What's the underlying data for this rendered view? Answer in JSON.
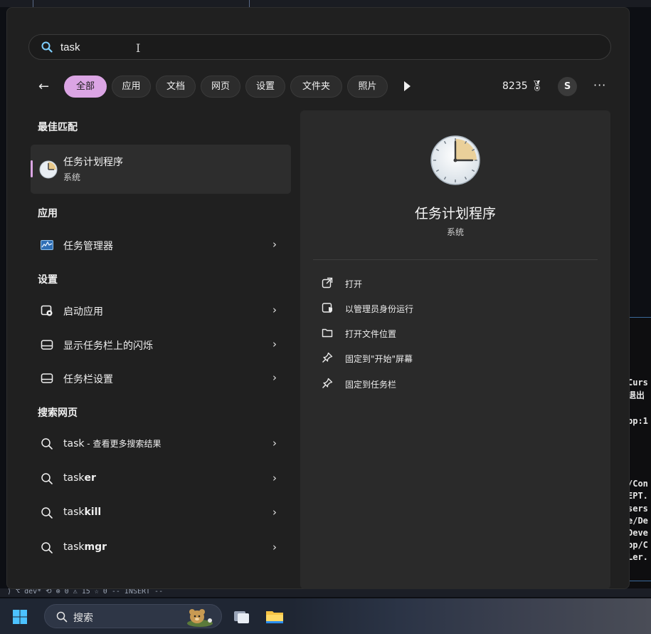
{
  "search": {
    "query": "task"
  },
  "filters": {
    "back_label": "←",
    "chips": [
      "全部",
      "应用",
      "文档",
      "网页",
      "设置",
      "文件夹",
      "照片"
    ],
    "points": "8235",
    "avatar_initial": "S",
    "more": "···"
  },
  "sections": {
    "best_match": "最佳匹配",
    "apps": "应用",
    "settings": "设置",
    "web": "搜索网页"
  },
  "best_match": {
    "title": "任务计划程序",
    "subtitle": "系统"
  },
  "apps": [
    {
      "label": "任务管理器"
    }
  ],
  "settings": [
    {
      "label": "启动应用"
    },
    {
      "label": "显示任务栏上的闪烁"
    },
    {
      "label": "任务栏设置"
    }
  ],
  "web": [
    {
      "prefix": "task",
      "suffix": " - 查看更多搜索结果"
    },
    {
      "prefix": "task",
      "bold": "er"
    },
    {
      "prefix": "task",
      "bold": "kill"
    },
    {
      "prefix": "task",
      "bold": "mgr"
    }
  ],
  "preview": {
    "title": "任务计划程序",
    "subtitle": "系统",
    "actions": [
      {
        "label": "打开",
        "icon": "open-icon"
      },
      {
        "label": "以管理员身份运行",
        "icon": "shield-icon"
      },
      {
        "label": "打开文件位置",
        "icon": "folder-icon"
      },
      {
        "label": "固定到\"开始\"屏幕",
        "icon": "pin-icon"
      },
      {
        "label": "固定到任务栏",
        "icon": "pin-icon"
      }
    ]
  },
  "taskbar": {
    "search_label": "搜索"
  },
  "background": {
    "status_line": "⟩  ⌥ dev* ⟲  ⊗ 0 ⚠ 15   ☆ 0   -- INSERT --",
    "terminal_lines": [
      "Curs",
      "退出",
      "pp:1",
      "/Con",
      "EPT.",
      "sers",
      "e/De",
      "Deve",
      "pp/C",
      "Ler."
    ]
  },
  "colors": {
    "accent": "#dba5e4",
    "panel": "#202020",
    "preview": "#2a2a2a"
  }
}
